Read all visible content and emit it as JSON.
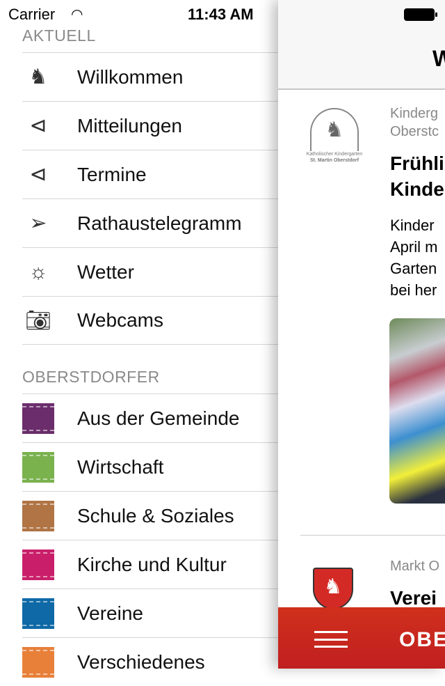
{
  "status": {
    "carrier": "Carrier",
    "time": "11:43 AM"
  },
  "menu": {
    "sections": [
      {
        "title": "AKTUELL",
        "items": [
          {
            "label": "Willkommen",
            "icon": "horse-icon"
          },
          {
            "label": "Mitteilungen",
            "icon": "megaphone-icon"
          },
          {
            "label": "Termine",
            "icon": "megaphone-icon"
          },
          {
            "label": "Rathaustelegramm",
            "icon": "paper-plane-icon"
          },
          {
            "label": "Wetter",
            "icon": "sun-icon"
          },
          {
            "label": "Webcams",
            "icon": "camera-icon"
          }
        ]
      },
      {
        "title": "OBERSTDORFER",
        "items": [
          {
            "label": "Aus der Gemeinde",
            "color": "#6b2d6b"
          },
          {
            "label": "Wirtschaft",
            "color": "#7ab24e"
          },
          {
            "label": "Schule & Soziales",
            "color": "#b07445"
          },
          {
            "label": "Kirche und Kultur",
            "color": "#c91f6a"
          },
          {
            "label": "Vereine",
            "color": "#0e69a6"
          },
          {
            "label": "Verschiedenes",
            "color": "#e8803a"
          }
        ]
      }
    ]
  },
  "main": {
    "nav_title": "W",
    "articles": [
      {
        "source_1": "Kinderg",
        "source_2": "Oberstc",
        "title_1": "Frühli",
        "title_2": "Kinde",
        "body": [
          "Kinder",
          "April m",
          "Garten",
          "bei her"
        ],
        "logo_text_1": "Katholischer Kindergarten",
        "logo_text_2": "St. Martin Oberstdorf"
      },
      {
        "source_1": "Markt O",
        "title_1": "Verei"
      }
    ],
    "bottom_bar": {
      "brand": "OBE",
      "accent": "#c8261e"
    }
  }
}
